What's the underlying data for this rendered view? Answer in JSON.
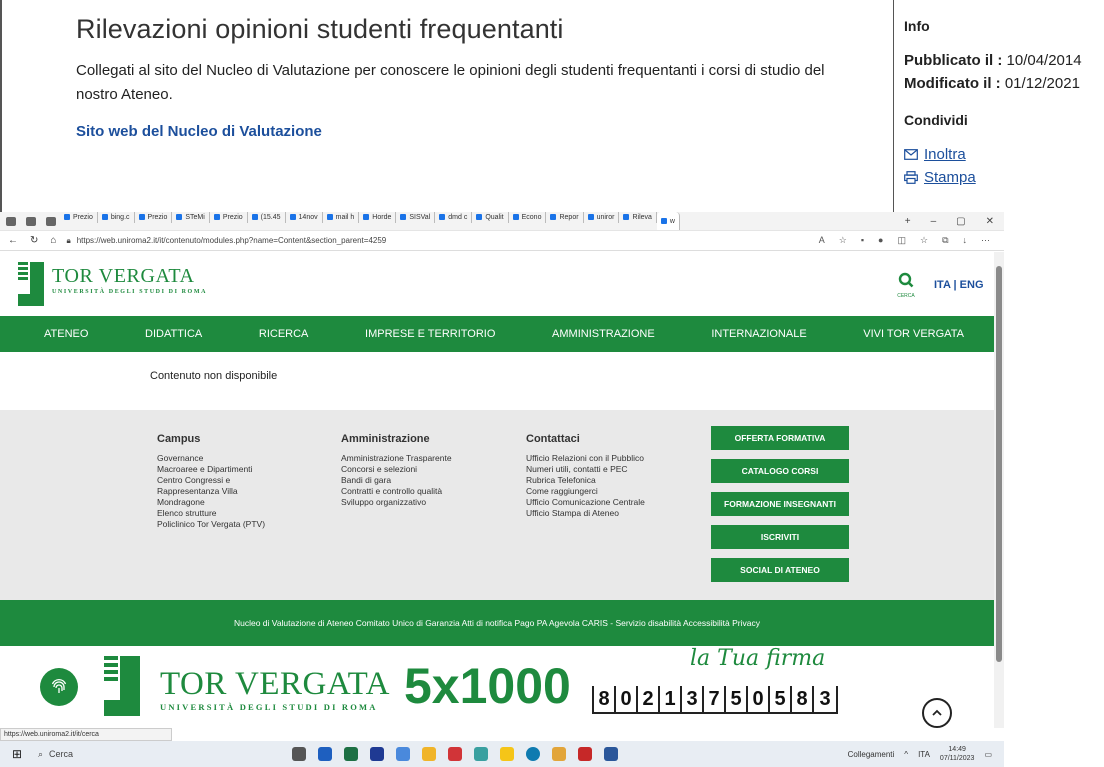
{
  "article": {
    "title": "Rilevazioni opinioni studenti frequentanti",
    "description": "Collegati al sito del Nucleo di Valutazione per conoscere le opinioni degli studenti frequentanti i corsi di studio del nostro Ateneo.",
    "link_text": "Sito web del Nucleo di Valutazione"
  },
  "info": {
    "heading": "Info",
    "published_label": "Pubblicato il :",
    "published_value": "10/04/2014",
    "modified_label": "Modificato il :",
    "modified_value": "01/12/2021",
    "share_heading": "Condividi",
    "forward": "Inoltra",
    "print": "Stampa"
  },
  "browser": {
    "tabs": [
      "Prezio",
      "bing.c",
      "Prezio",
      "STeMi",
      "Prezio",
      "(15.45",
      "14nov",
      "mail h",
      "Horde",
      "SISVal",
      "dmd c",
      "Qualit",
      "Econo",
      "Repor",
      "uniror",
      "Rileva",
      "w"
    ],
    "url": "https://web.uniroma2.it/it/contenuto/modules.php?name=Content&section_parent=4259",
    "status_url": "https://web.uniroma2.it/it/cerca"
  },
  "site": {
    "logo_big": "TOR VERGATA",
    "logo_small": "UNIVERSITÀ DEGLI STUDI DI ROMA",
    "search_label": "CERCA",
    "lang": "ITA | ENG",
    "nav": [
      "ATENEO",
      "DIDATTICA",
      "RICERCA",
      "IMPRESE E TERRITORIO",
      "AMMINISTRAZIONE",
      "INTERNAZIONALE",
      "VIVI TOR VERGATA"
    ],
    "content_message": "Contenuto non disponibile",
    "footer": {
      "campus": {
        "title": "Campus",
        "items": [
          "Governance",
          "Macroaree e Dipartimenti",
          "Centro Congressi e",
          "Rappresentanza Villa",
          "Mondragone",
          "Elenco strutture",
          "Policlinico Tor Vergata (PTV)"
        ]
      },
      "amministrazione": {
        "title": "Amministrazione",
        "items": [
          "Amministrazione Trasparente",
          "Concorsi e selezioni",
          "Bandi di gara",
          "Contratti e controllo qualità",
          "Sviluppo organizzativo"
        ]
      },
      "contattaci": {
        "title": "Contattaci",
        "items": [
          "Ufficio Relazioni con il Pubblico",
          "Numeri utili, contatti e PEC",
          "Rubrica Telefonica",
          "Come raggiungerci",
          "Ufficio Comunicazione Centrale",
          "Ufficio Stampa di Ateneo"
        ]
      },
      "buttons": [
        "OFFERTA FORMATIVA",
        "CATALOGO CORSI",
        "FORMAZIONE INSEGNANTI",
        "ISCRIVITI",
        "SOCIAL DI ATENEO"
      ]
    },
    "bottom_links": "Nucleo di Valutazione di Ateneo   Comitato Unico di Garanzia   Atti di notifica   Pago PA   Agevola   CARIS - Servizio disabilità   Accessibilità   Privacy",
    "banner": {
      "big": "TOR VERGATA",
      "small": "UNIVERSITÀ DEGLI STUDI DI ROMA",
      "five_x": "5x1000",
      "signature": "la Tua firma",
      "code": [
        "8",
        "0",
        "2",
        "1",
        "3",
        "7",
        "5",
        "0",
        "5",
        "8",
        "3"
      ]
    }
  },
  "taskbar": {
    "search": "Cerca",
    "links": "Collegamenti",
    "lang": "ITA",
    "time": "14:49",
    "date": "07/11/2023"
  },
  "colors": {
    "green": "#1e8a3e",
    "link_blue": "#1c4f9c"
  }
}
